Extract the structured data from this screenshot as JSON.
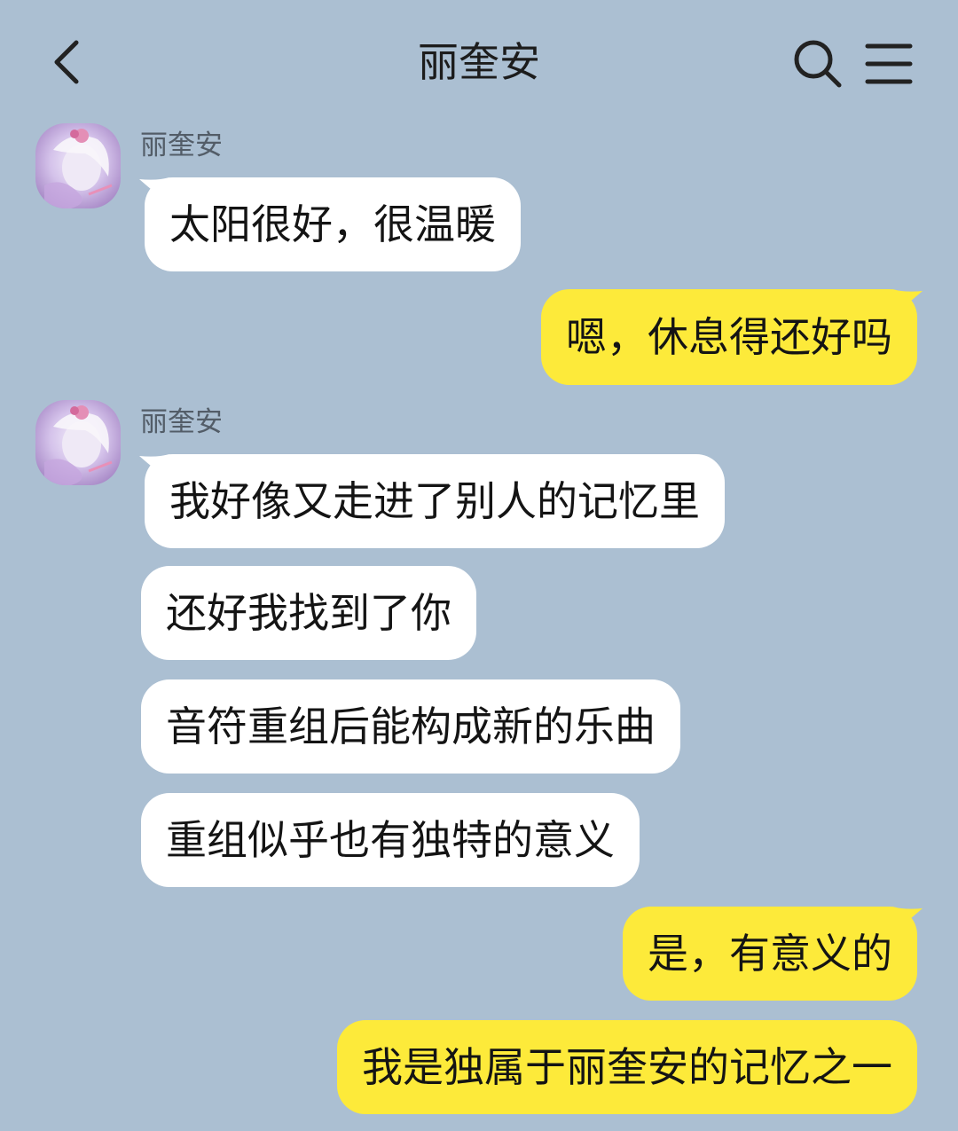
{
  "header": {
    "title": "丽奎安"
  },
  "contact": {
    "name": "丽奎安"
  },
  "messages": [
    {
      "side": "in",
      "text": "太阳很好，很温暖"
    },
    {
      "side": "out",
      "text": "嗯，休息得还好吗"
    },
    {
      "side": "in",
      "text": "我好像又走进了别人的记忆里"
    },
    {
      "side": "in",
      "text": "还好我找到了你"
    },
    {
      "side": "in",
      "text": "音符重组后能构成新的乐曲"
    },
    {
      "side": "in",
      "text": "重组似乎也有独特的意义"
    },
    {
      "side": "out",
      "text": "是，有意义的"
    },
    {
      "side": "out",
      "text": "我是独属于丽奎安的记忆之一"
    }
  ],
  "icons": {
    "back": "chevron-left-icon",
    "search": "search-icon",
    "menu": "menu-icon"
  },
  "colors": {
    "background": "#abbfd2",
    "incoming_bubble": "#ffffff",
    "outgoing_bubble": "#fdea3a"
  }
}
